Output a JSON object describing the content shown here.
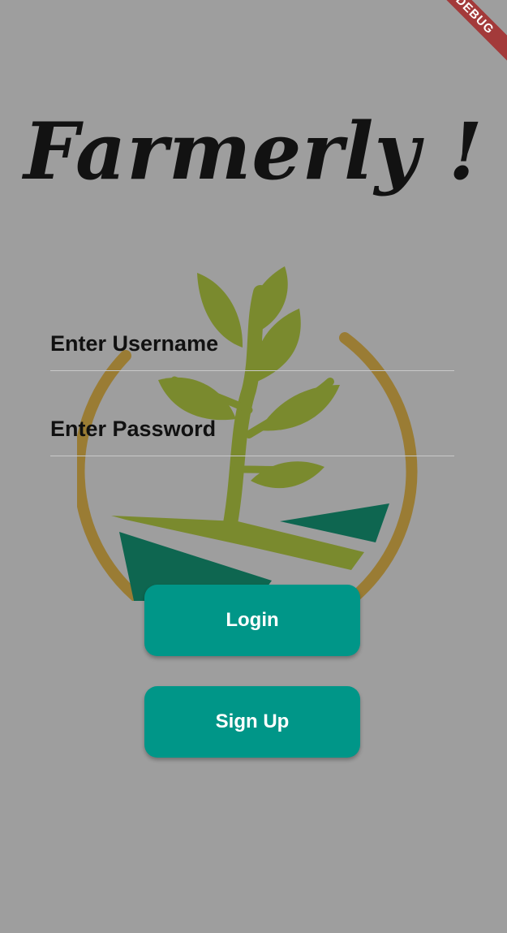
{
  "app": {
    "title": "Farmerly !",
    "debug_banner": "DEBUG"
  },
  "form": {
    "username_placeholder": "Enter Username",
    "password_placeholder": "Enter Password"
  },
  "actions": {
    "login_label": "Login",
    "signup_label": "Sign Up"
  },
  "icons": {
    "logo": "plant-sprout-logo"
  },
  "colors": {
    "background": "#9e9e9e",
    "button": "#009688",
    "button_text": "#ffffff",
    "title": "#121212",
    "logo_leaf": "#7a8a2e",
    "logo_ring": "#9a7a2e",
    "logo_field_dark": "#0e6650",
    "debug_banner": "#a33a3a"
  }
}
